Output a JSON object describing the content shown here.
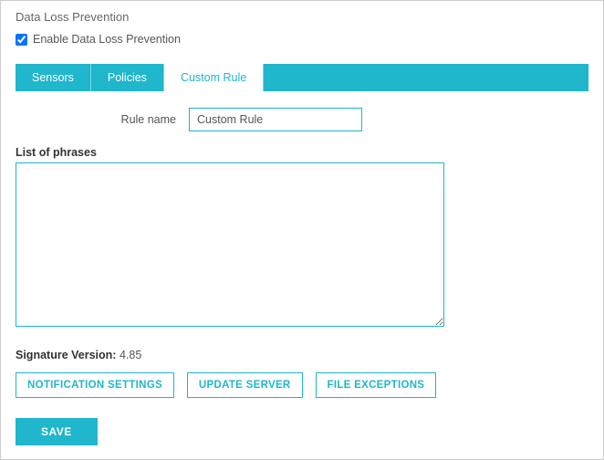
{
  "title": "Data Loss Prevention",
  "enable": {
    "checked": true,
    "label": "Enable Data Loss Prevention"
  },
  "tabs": [
    {
      "label": "Sensors",
      "active": false
    },
    {
      "label": "Policies",
      "active": false
    },
    {
      "label": "Custom Rule",
      "active": true
    }
  ],
  "form": {
    "rule_name_label": "Rule name",
    "rule_name_value": "Custom Rule",
    "phrases_label": "List of phrases",
    "phrases_value": ""
  },
  "signature": {
    "label": "Signature Version:",
    "value": "4.85"
  },
  "buttons": {
    "notification_settings": "NOTIFICATION SETTINGS",
    "update_server": "UPDATE SERVER",
    "file_exceptions": "FILE EXCEPTIONS",
    "save": "SAVE"
  },
  "colors": {
    "accent": "#20b6cc"
  }
}
